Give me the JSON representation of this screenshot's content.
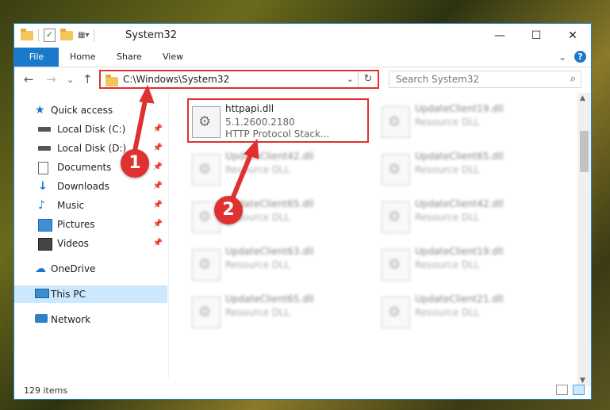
{
  "window": {
    "title": "System32",
    "controls": {
      "minimize": "—",
      "maximize": "☐",
      "close": "✕"
    }
  },
  "ribbon": {
    "tabs": [
      "File",
      "Home",
      "Share",
      "View"
    ],
    "expand_icon": "⌄",
    "help_label": "?"
  },
  "navigation": {
    "back": "←",
    "forward": "→",
    "recent": "⌄",
    "up": "↑",
    "address": "C:\\Windows\\System32",
    "address_dropdown": "⌄",
    "refresh": "↻",
    "search_placeholder": "Search System32",
    "search_icon": "⌕"
  },
  "sidebar": {
    "items": [
      {
        "label": "Quick access",
        "icon": "star-icon",
        "pinned": false
      },
      {
        "label": "Local Disk (C:)",
        "icon": "disk-icon",
        "pinned": true
      },
      {
        "label": "Local Disk (D:)",
        "icon": "disk-icon",
        "pinned": true
      },
      {
        "label": "Documents",
        "icon": "documents-icon",
        "pinned": true
      },
      {
        "label": "Downloads",
        "icon": "download-icon",
        "pinned": true
      },
      {
        "label": "Music",
        "icon": "music-icon",
        "pinned": true
      },
      {
        "label": "Pictures",
        "icon": "pictures-icon",
        "pinned": true
      },
      {
        "label": "Videos",
        "icon": "videos-icon",
        "pinned": true
      },
      {
        "label": "OneDrive",
        "icon": "onedrive-icon",
        "pinned": false
      },
      {
        "label": "This PC",
        "icon": "pc-icon",
        "pinned": false,
        "selected": true
      },
      {
        "label": "Network",
        "icon": "network-icon",
        "pinned": false
      }
    ],
    "pin_glyph": "📌"
  },
  "files": [
    {
      "name": "httpapi.dll",
      "line1": "5.1.2600.2180",
      "line2": "HTTP Protocol Stack...",
      "highlighted": true
    },
    {
      "name": "UpdateClient19.dll",
      "line1": "Resource DLL",
      "blurred": true
    },
    {
      "name": "UpdateClient42.dll",
      "line1": "Resource DLL",
      "blurred": true
    },
    {
      "name": "UpdateClient65.dll",
      "line1": "Resource DLL",
      "blurred": true
    },
    {
      "name": "UpdateClient65.dll",
      "line1": "Resource DLL",
      "blurred": true
    },
    {
      "name": "UpdateClient42.dll",
      "line1": "Resource DLL",
      "blurred": true
    },
    {
      "name": "UpdateClient63.dll",
      "line1": "Resource DLL",
      "blurred": true
    },
    {
      "name": "UpdateClient19.dll",
      "line1": "Resource DLL",
      "blurred": true
    },
    {
      "name": "UpdateClient65.dll",
      "line1": "Resource DLL",
      "blurred": true
    },
    {
      "name": "UpdateClient21.dll",
      "line1": "Resource DLL",
      "blurred": true
    }
  ],
  "status": {
    "item_count": "129 items"
  },
  "annotations": {
    "badge1": "1",
    "badge2": "2"
  },
  "colors": {
    "accent": "#1979ca",
    "highlight": "#e03131",
    "selected": "#cce8ff"
  }
}
